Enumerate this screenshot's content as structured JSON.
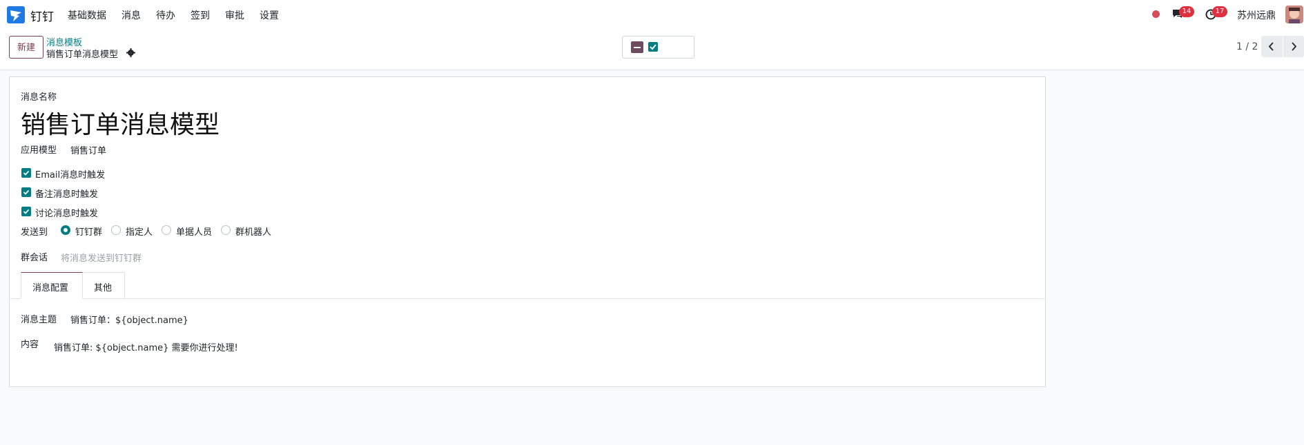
{
  "app": {
    "name": "钉钉"
  },
  "nav": {
    "menu": [
      "基础数据",
      "消息",
      "待办",
      "签到",
      "审批",
      "设置"
    ],
    "chat_count": "14",
    "activity_count": "17",
    "company": "苏州远鼎",
    "status_color": "#d44c59"
  },
  "control": {
    "new_label": "新建",
    "breadcrumb_parent": "消息模板",
    "breadcrumb_current": "销售订单消息模型",
    "pager": "1 / 2"
  },
  "form": {
    "name_label": "消息名称",
    "name_value": "销售订单消息模型",
    "model_label": "应用模型",
    "model_value": "销售订单",
    "checkboxes": [
      {
        "label": "Email消息时触发",
        "checked": true
      },
      {
        "label": "备注消息时触发",
        "checked": true
      },
      {
        "label": "讨论消息时触发",
        "checked": true
      }
    ],
    "send_to_label": "发送到",
    "send_to_options": [
      {
        "label": "钉钉群",
        "selected": true
      },
      {
        "label": "指定人",
        "selected": false
      },
      {
        "label": "单据人员",
        "selected": false
      },
      {
        "label": "群机器人",
        "selected": false
      }
    ],
    "group_chat_label": "群会话",
    "group_chat_placeholder": "将消息发送到钉钉群",
    "tabs": [
      {
        "label": "消息配置",
        "active": true
      },
      {
        "label": "其他",
        "active": false
      }
    ],
    "subject_label": "消息主题",
    "subject_value": "销售订单：${object.name}",
    "content_label": "内容",
    "content_value": "销售订单: ${object.name} 需要你进行处理!"
  },
  "colors": {
    "brand": "#7c3f52",
    "accent": "#017e84",
    "badge": "#e02f3f"
  }
}
